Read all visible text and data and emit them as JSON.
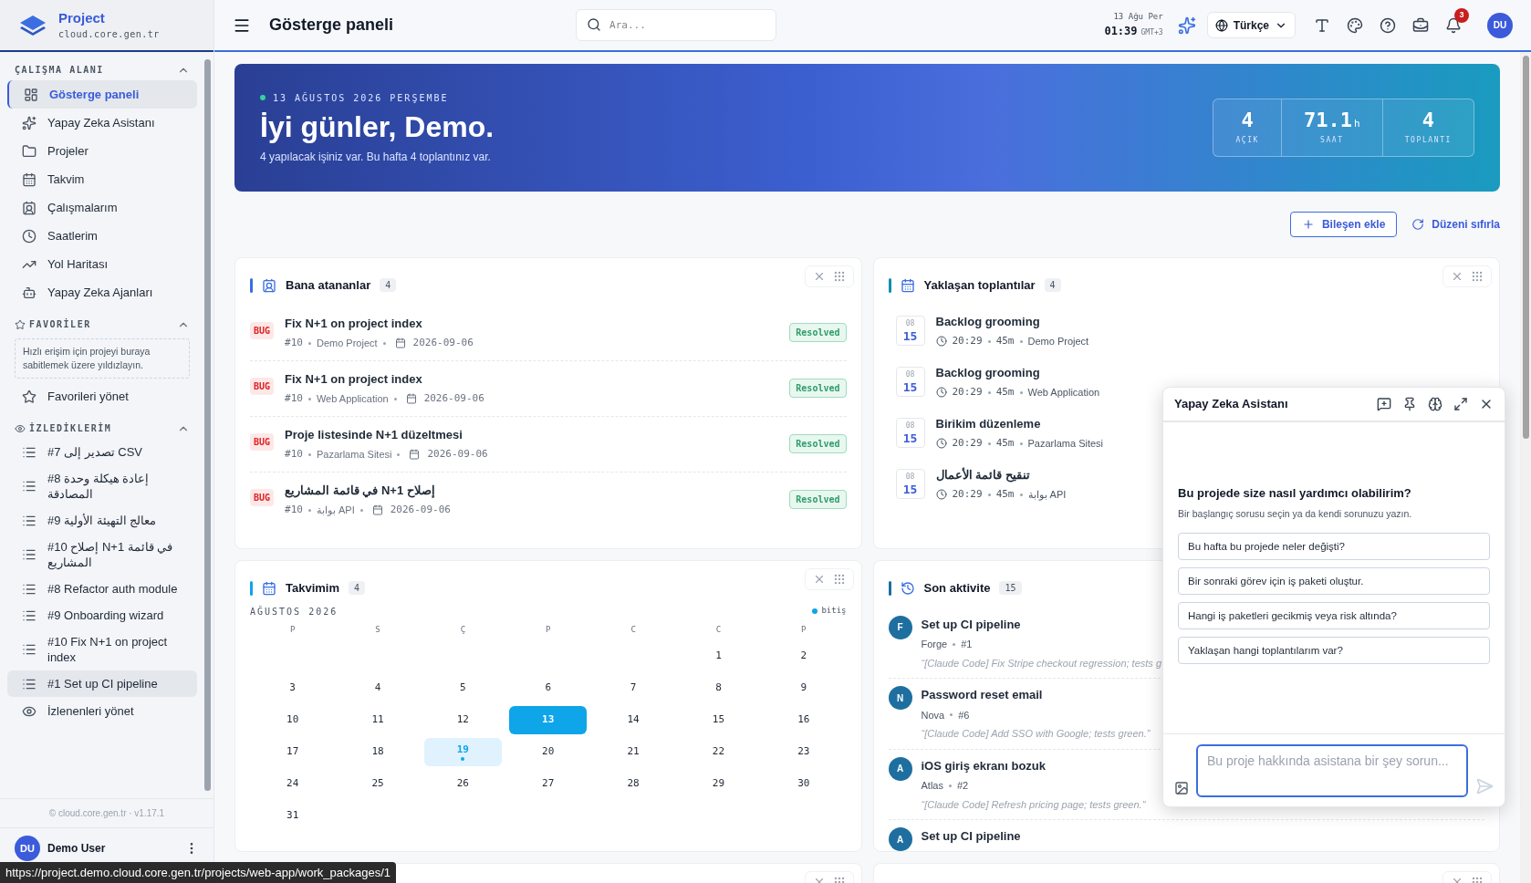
{
  "sidebar": {
    "brand": {
      "name": "Project",
      "domain": "cloud.core.gen.tr"
    },
    "sections": [
      {
        "kind": "nav",
        "title": "ÇALIŞMA ALANI",
        "expanded": true,
        "items": [
          {
            "label": "Gösterge paneli",
            "selected": true
          },
          {
            "label": "Yapay Zeka Asistanı",
            "selected": false
          },
          {
            "label": "Projeler",
            "selected": false
          },
          {
            "label": "Takvim",
            "selected": false
          },
          {
            "label": "Çalışmalarım",
            "selected": false
          },
          {
            "label": "Saatlerim",
            "selected": false
          },
          {
            "label": "Yol Haritası",
            "selected": false
          },
          {
            "label": "Yapay Zeka Ajanları",
            "selected": false
          }
        ]
      },
      {
        "kind": "favorites",
        "title": "FAVORİLER",
        "expanded": true,
        "hint": "Hızlı erişim için projeyi buraya sabitlemek üzere yıldızlayın.",
        "manage": "Favorileri yönet"
      },
      {
        "kind": "watched",
        "title": "İZLEDİKLERİM",
        "expanded": true,
        "items": [
          {
            "label": "#7 تصدير إلى CSV",
            "selected": false
          },
          {
            "label": "#8 إعادة هيكلة وحدة المصادقة",
            "selected": false
          },
          {
            "label": "#9 معالج التهيئة الأولية",
            "selected": false
          },
          {
            "label": "#10 إصلاح N+1 في قائمة المشاريع",
            "selected": false
          },
          {
            "label": "#8 Refactor auth module",
            "selected": false
          },
          {
            "label": "#9 Onboarding wizard",
            "selected": false
          },
          {
            "label": "#10 Fix N+1 on project index",
            "selected": false
          },
          {
            "label": "#1 Set up CI pipeline",
            "selected": true
          }
        ],
        "manage": "İzlenenleri yönet"
      }
    ],
    "footer": "© cloud.core.gen.tr · v1.17.1",
    "user": {
      "initials": "DU",
      "name": "Demo User"
    }
  },
  "header": {
    "title": "Gösterge paneli",
    "search": {
      "placeholder": "Ara..."
    },
    "date": "13 Ağu Per",
    "time": "01:39",
    "timezone": "GMT+3",
    "language": "Türkçe",
    "notifications": "3",
    "avatar": "DU"
  },
  "banner": {
    "date": "13 AĞUSTOS 2026 PERŞEMBE",
    "greeting": "İyi günler, Demo.",
    "summary": "4 yapılacak işiniz var. Bu hafta 4 toplantınız var.",
    "stats": [
      {
        "value": "4",
        "label": "AÇIK"
      },
      {
        "value": "71.1",
        "unit": "h",
        "label": "SAAT"
      },
      {
        "value": "4",
        "label": "TOPLANTI"
      }
    ]
  },
  "actions": {
    "add": "Bileşen ekle",
    "reset": "Düzeni sıfırla"
  },
  "assigned": {
    "title": "Bana atananlar",
    "count": "4",
    "items": [
      {
        "type": "BUG",
        "title": "Fix N+1 on project index",
        "id": "#10",
        "project": "Demo Project",
        "date": "2026-09-06",
        "status": "Resolved"
      },
      {
        "type": "BUG",
        "title": "Fix N+1 on project index",
        "id": "#10",
        "project": "Web Application",
        "date": "2026-09-06",
        "status": "Resolved"
      },
      {
        "type": "BUG",
        "title": "Proje listesinde N+1 düzeltmesi",
        "id": "#10",
        "project": "Pazarlama Sitesi",
        "date": "2026-09-06",
        "status": "Resolved"
      },
      {
        "type": "BUG",
        "title": "إصلاح N+1 في قائمة المشاريع",
        "id": "#10",
        "project": "بوابة API",
        "date": "2026-09-06",
        "status": "Resolved"
      }
    ]
  },
  "meetings": {
    "title": "Yaklaşan toplantılar",
    "count": "4",
    "items": [
      {
        "month": "08",
        "day": "15",
        "title": "Backlog grooming",
        "time": "20:29",
        "duration": "45m",
        "project": "Demo Project"
      },
      {
        "month": "08",
        "day": "15",
        "title": "Backlog grooming",
        "time": "20:29",
        "duration": "45m",
        "project": "Web Application"
      },
      {
        "month": "08",
        "day": "15",
        "title": "Birikim düzenleme",
        "time": "20:29",
        "duration": "45m",
        "project": "Pazarlama Sitesi"
      },
      {
        "month": "08",
        "day": "15",
        "title": "تنقيح قائمة الأعمال",
        "time": "20:29",
        "duration": "45m",
        "project": "بوابة API"
      }
    ]
  },
  "calendar": {
    "title": "Takvimim",
    "count": "4",
    "month": "AĞUSTOS 2026",
    "legend": "bitiş",
    "weekdays": [
      "P",
      "S",
      "Ç",
      "P",
      "C",
      "C",
      "P"
    ],
    "weeks": [
      {
        "kind": "trailing",
        "days": [
          {
            "day": "1",
            "today": false,
            "due": false
          },
          {
            "day": "2",
            "today": false,
            "due": false
          }
        ]
      },
      {
        "kind": "full",
        "days": [
          {
            "day": "3",
            "today": false,
            "due": false
          },
          {
            "day": "4",
            "today": false,
            "due": false
          },
          {
            "day": "5",
            "today": false,
            "due": false
          },
          {
            "day": "6",
            "today": false,
            "due": false
          },
          {
            "day": "7",
            "today": false,
            "due": false
          },
          {
            "day": "8",
            "today": false,
            "due": false
          },
          {
            "day": "9",
            "today": false,
            "due": false
          }
        ]
      },
      {
        "kind": "full",
        "days": [
          {
            "day": "10",
            "today": false,
            "due": false
          },
          {
            "day": "11",
            "today": false,
            "due": false
          },
          {
            "day": "12",
            "today": false,
            "due": false
          },
          {
            "day": "13",
            "today": true,
            "due": false
          },
          {
            "day": "14",
            "today": false,
            "due": false
          },
          {
            "day": "15",
            "today": false,
            "due": false
          },
          {
            "day": "16",
            "today": false,
            "due": false
          }
        ]
      },
      {
        "kind": "full",
        "days": [
          {
            "day": "17",
            "today": false,
            "due": false
          },
          {
            "day": "18",
            "today": false,
            "due": false
          },
          {
            "day": "19",
            "today": false,
            "due": true
          },
          {
            "day": "20",
            "today": false,
            "due": false
          },
          {
            "day": "21",
            "today": false,
            "due": false
          },
          {
            "day": "22",
            "today": false,
            "due": false
          },
          {
            "day": "23",
            "today": false,
            "due": false
          }
        ]
      },
      {
        "kind": "full",
        "days": [
          {
            "day": "24",
            "today": false,
            "due": false
          },
          {
            "day": "25",
            "today": false,
            "due": false
          },
          {
            "day": "26",
            "today": false,
            "due": false
          },
          {
            "day": "27",
            "today": false,
            "due": false
          },
          {
            "day": "28",
            "today": false,
            "due": false
          },
          {
            "day": "29",
            "today": false,
            "due": false
          },
          {
            "day": "30",
            "today": false,
            "due": false
          }
        ]
      },
      {
        "kind": "leading",
        "days": [
          {
            "day": "31",
            "today": false,
            "due": false
          }
        ]
      }
    ]
  },
  "activity": {
    "title": "Son aktivite",
    "count": "15",
    "items": [
      {
        "initial": "F",
        "title": "Set up CI pipeline",
        "agent": "Forge",
        "id": "#1",
        "quote": "“[Claude Code] Fix Stripe checkout regression; tests g"
      },
      {
        "initial": "N",
        "title": "Password reset email",
        "agent": "Nova",
        "id": "#6",
        "quote": "“[Claude Code] Add SSO with Google; tests green.”"
      },
      {
        "initial": "A",
        "title": "iOS giriş ekranı bozuk",
        "agent": "Atlas",
        "id": "#2",
        "quote": "“[Claude Code] Refresh pricing page; tests green.”"
      },
      {
        "initial": "A",
        "title": "Set up CI pipeline"
      }
    ]
  },
  "assistant": {
    "title": "Yapay Zeka Asistanı",
    "heading": "Bu projede size nasıl yardımcı olabilirim?",
    "subheading": "Bir başlangıç sorusu seçin ya da kendi sorunuzu yazın.",
    "suggestions": [
      "Bu hafta bu projede neler değişti?",
      "Bir sonraki görev için iş paketi oluştur.",
      "Hangi iş paketleri gecikmiş veya risk altında?",
      "Yaklaşan hangi toplantılarım var?"
    ],
    "input": {
      "placeholder": "Bu proje hakkında asistana bir şey sorun..."
    }
  },
  "status_url": "https://project.demo.cloud.core.gen.tr/projects/web-app/work_packages/1"
}
